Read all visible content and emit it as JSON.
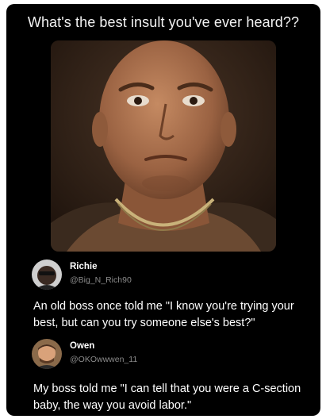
{
  "post": {
    "title": "What's the best insult you've ever heard??"
  },
  "replies": [
    {
      "name": "Richie",
      "handle": "@Big_N_Rich90",
      "text": "An old boss once told me \"I know you're trying your best, but can you try someone else's best?\""
    },
    {
      "name": "Owen",
      "handle": "@OKOwwwen_11",
      "text": "My boss told me \"I can tell that you were a C-section baby, the way you avoid labor.\""
    }
  ],
  "colors": {
    "background": "#000000",
    "text": "#ffffff",
    "handle": "#8b8b8b"
  }
}
